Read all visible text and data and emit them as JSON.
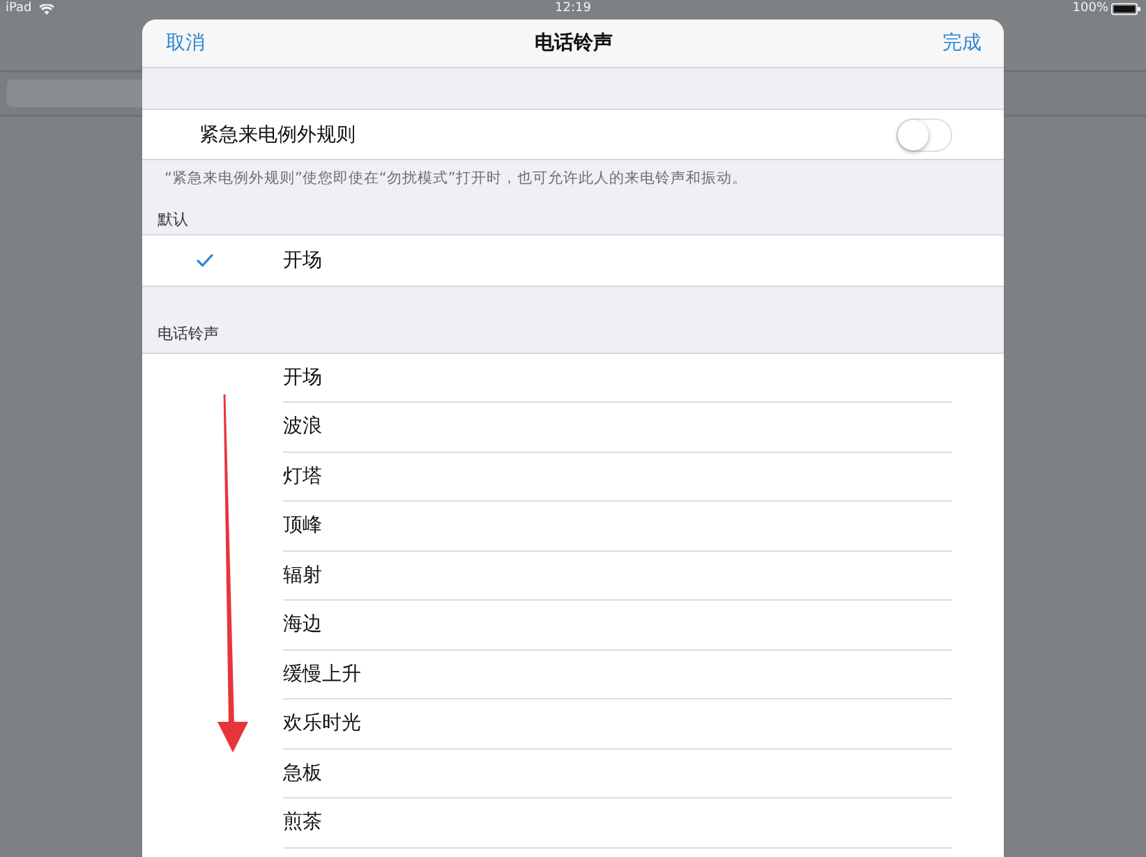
{
  "status_bar": {
    "device": "iPad",
    "time": "12:19",
    "battery": "100%"
  },
  "sheet": {
    "nav_bar": {
      "cancel": "取消",
      "title": "电话铃声",
      "done": "完成"
    },
    "emergency_bypass": {
      "label": "紧急来电例外规则",
      "on": false,
      "footer": "“紧急来电例外规则”使您即使在“勿扰模式”打开时，也可允许此人的来电铃声和振动。"
    },
    "default_section": {
      "header": "默认",
      "items": [
        {
          "label": "开场",
          "selected": true
        }
      ]
    },
    "ringtone_section": {
      "header": "电话铃声",
      "items": [
        {
          "label": "开场",
          "selected": false
        },
        {
          "label": "波浪",
          "selected": false
        },
        {
          "label": "灯塔",
          "selected": false
        },
        {
          "label": "顶峰",
          "selected": false
        },
        {
          "label": "辐射",
          "selected": false
        },
        {
          "label": "海边",
          "selected": false
        },
        {
          "label": "缓慢上升",
          "selected": false
        },
        {
          "label": "欢乐时光",
          "selected": false
        },
        {
          "label": "急板",
          "selected": false
        },
        {
          "label": "煎茶",
          "selected": false
        }
      ]
    }
  }
}
